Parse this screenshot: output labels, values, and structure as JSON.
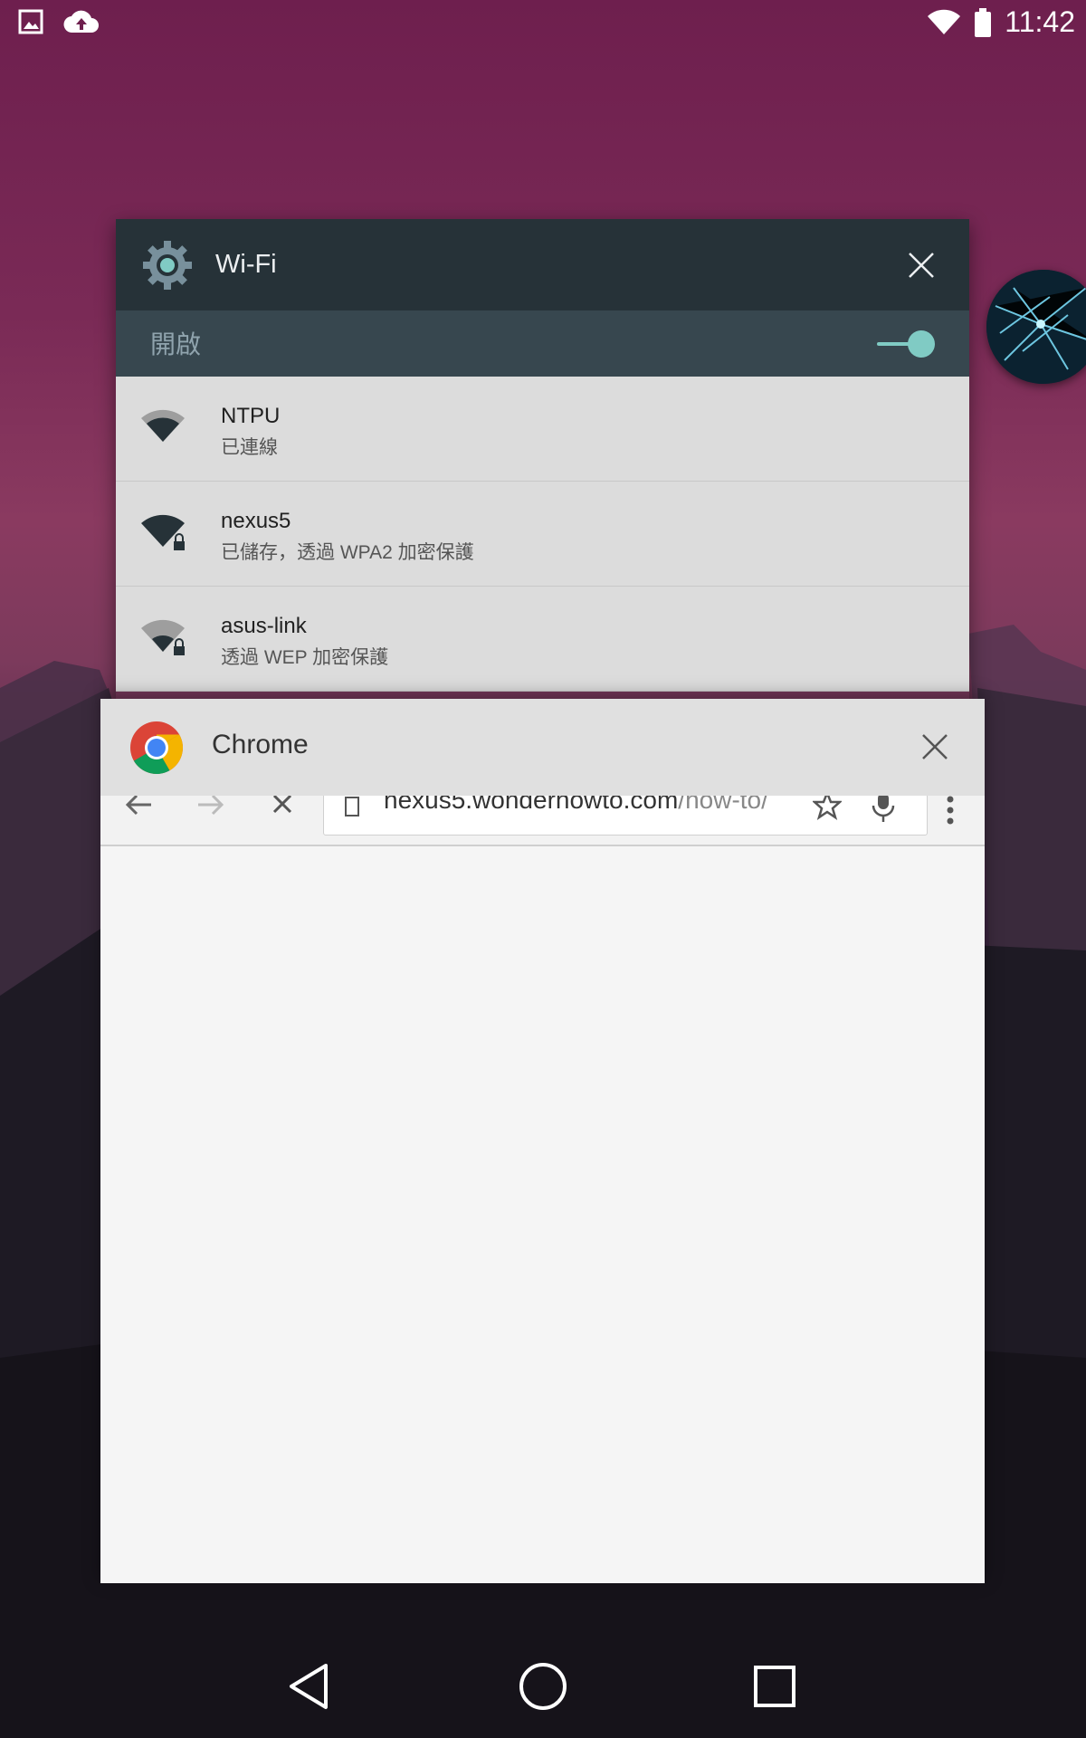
{
  "status_bar": {
    "time": "11:42",
    "left_icons": [
      "image-icon",
      "cloud-upload-icon"
    ],
    "right_icons": [
      "wifi-icon",
      "battery-icon"
    ]
  },
  "wifi_card": {
    "title": "Wi-Fi",
    "toggle_label": "開啟",
    "toggle_on": true,
    "accent_color": "#80cbc4",
    "networks": [
      {
        "name": "NTPU",
        "status": "已連線",
        "secured": false
      },
      {
        "name": "nexus5",
        "status": "已儲存，透過 WPA2 加密保護",
        "secured": true
      },
      {
        "name": "asus-link",
        "status": "透過 WEP 加密保護",
        "secured": true
      }
    ]
  },
  "chrome_card": {
    "title": "Chrome",
    "url_host": "nexus5.wonderhowto.com",
    "url_path": "/how-to/"
  },
  "nav_bar": {
    "buttons": [
      "back-icon",
      "home-icon",
      "recents-icon"
    ]
  }
}
